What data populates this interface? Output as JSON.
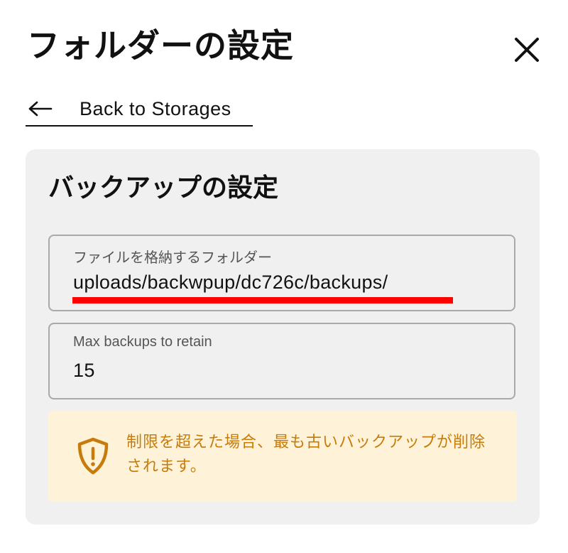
{
  "dialog": {
    "title": "フォルダーの設定",
    "close_icon": "close-icon"
  },
  "back_link": {
    "icon": "arrow-left-icon",
    "label": "Back to Storages"
  },
  "section": {
    "title": "バックアップの設定",
    "folder_field": {
      "label": "ファイルを格納するフォルダー",
      "value": "uploads/backwpup/dc726c/backups/",
      "highlight_color": "#ff0000"
    },
    "max_backups_field": {
      "label": "Max backups to retain",
      "value": "15"
    },
    "notice": {
      "icon": "shield-alert-icon",
      "text": "制限を超えた場合、最も古いバックアップが削除されます。",
      "color": "#c77b0a",
      "background": "#fef3d8"
    }
  }
}
